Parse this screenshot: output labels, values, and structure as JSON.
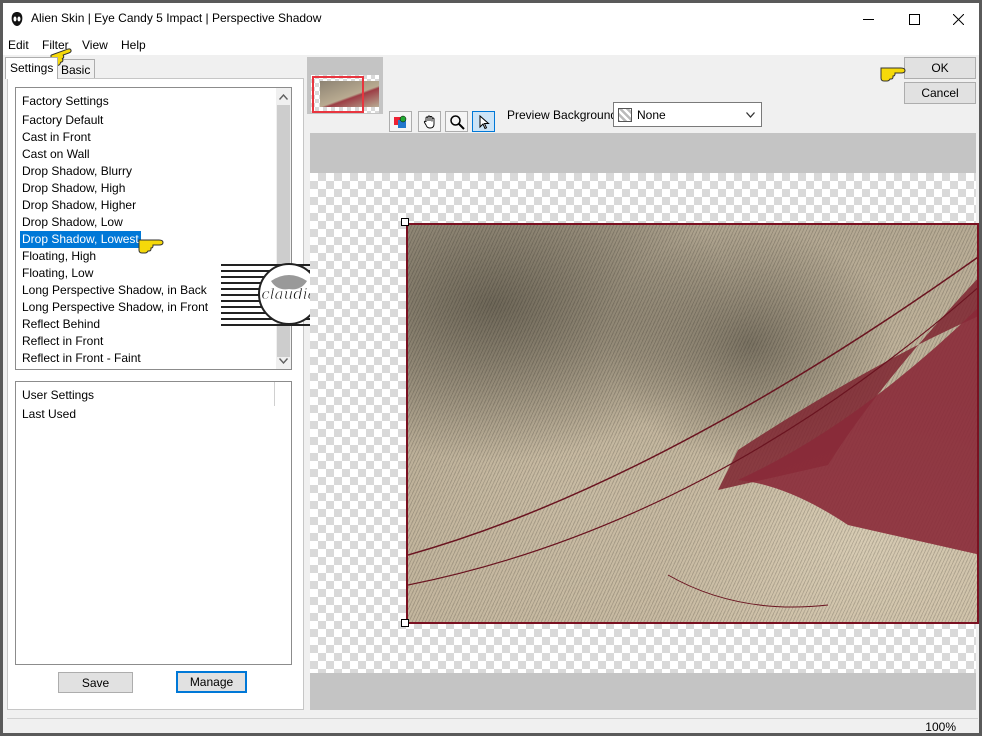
{
  "window": {
    "title": "Alien Skin | Eye Candy 5 Impact | Perspective Shadow"
  },
  "menu": [
    "Edit",
    "Filter",
    "View",
    "Help"
  ],
  "tabs": {
    "settings": "Settings",
    "basic": "Basic"
  },
  "factory": {
    "header": "Factory Settings",
    "items": [
      "Factory Default",
      "Cast in Front",
      "Cast on Wall",
      "Drop Shadow, Blurry",
      "Drop Shadow, High",
      "Drop Shadow, Higher",
      "Drop Shadow, Low",
      "Drop Shadow, Lowest",
      "Floating, High",
      "Floating, Low",
      "Long Perspective Shadow, in Back",
      "Long Perspective Shadow, in Front",
      "Reflect Behind",
      "Reflect in Front",
      "Reflect in Front - Faint"
    ],
    "selected": "Drop Shadow, Lowest"
  },
  "user": {
    "header": "User Settings",
    "items": [
      "Last Used"
    ]
  },
  "buttons": {
    "save": "Save",
    "manage": "Manage",
    "ok": "OK",
    "cancel": "Cancel"
  },
  "preview": {
    "background_label": "Preview Background:",
    "background_value": "None",
    "zoom": "100%"
  },
  "watermark": {
    "text": "claudia"
  },
  "colors": {
    "selection": "#0078d7",
    "frame": "#7a1020",
    "pointer_hand": "#f5d90a"
  }
}
